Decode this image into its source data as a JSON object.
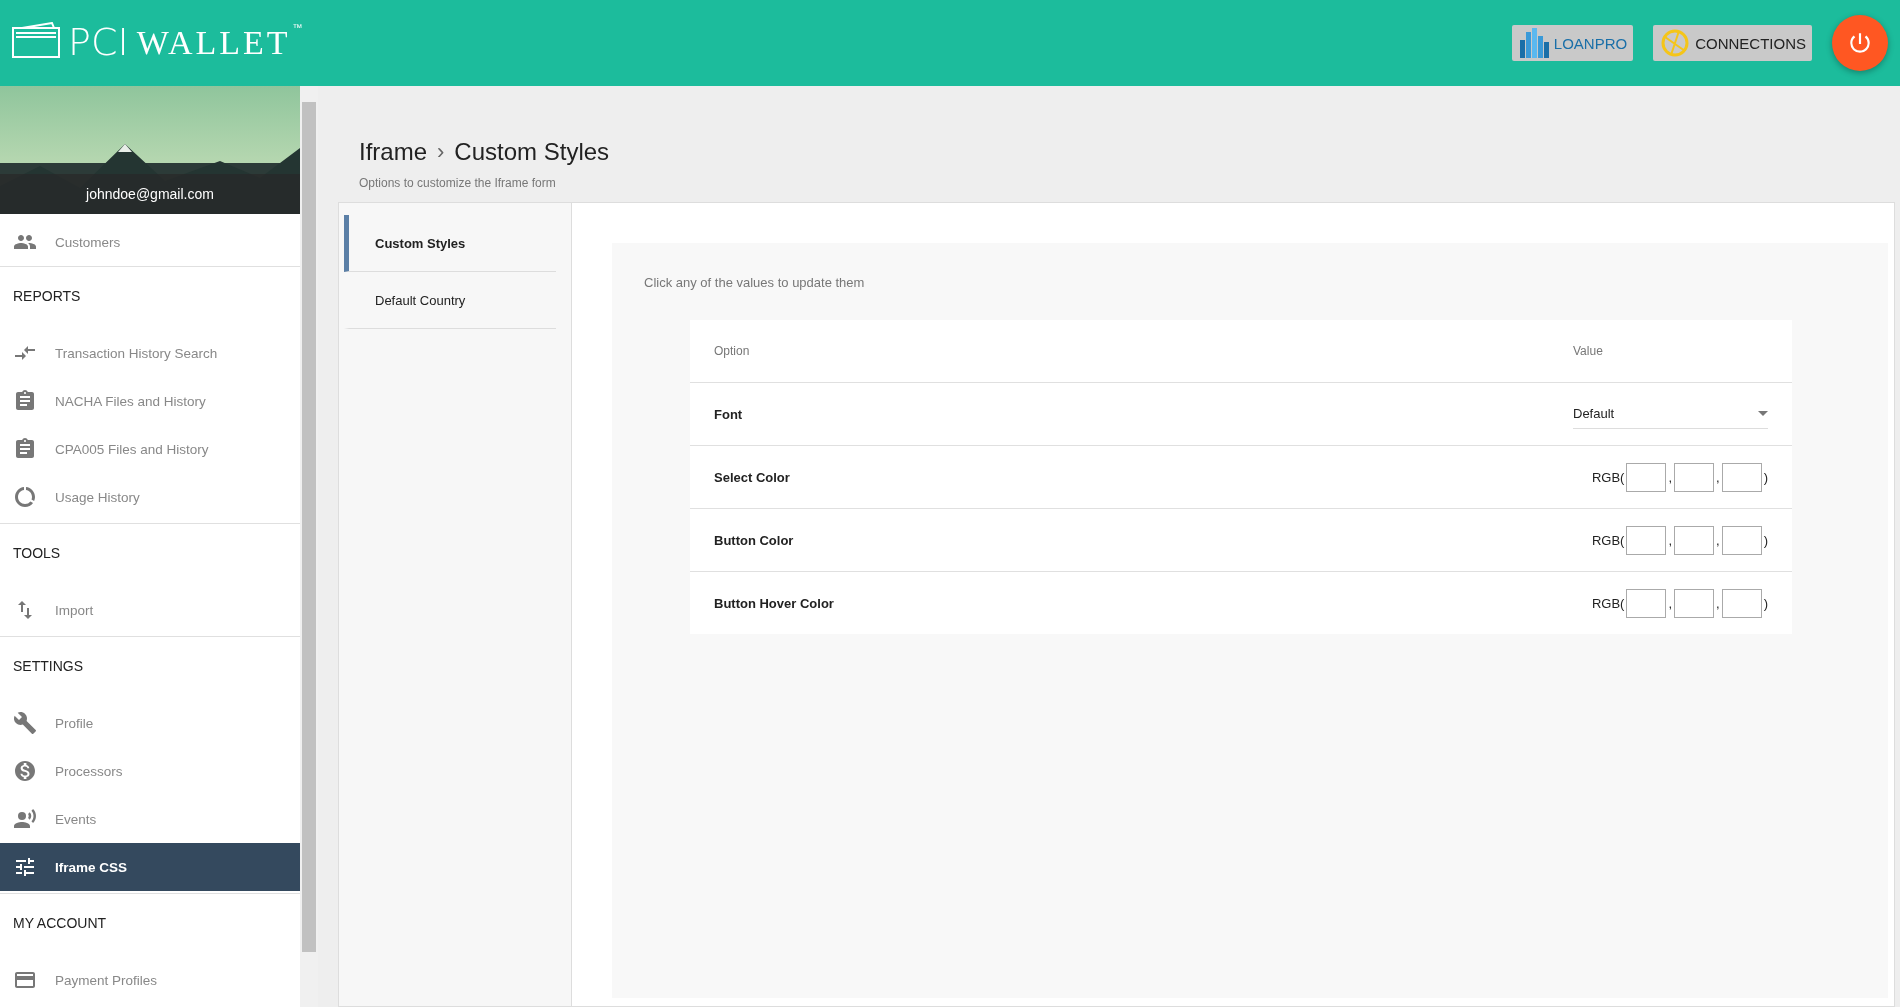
{
  "header": {
    "logo": {
      "first": "PCI",
      "second": "WALLET",
      "trademark": "™"
    },
    "buttons": [
      {
        "kind": "loanpro",
        "label": "LOANPRO"
      },
      {
        "kind": "connections",
        "label": "CONNECTIONS"
      }
    ]
  },
  "sidebar": {
    "user_email": "johndoe@gmail.com",
    "top_items": [
      {
        "label": "Customers",
        "selected": false
      }
    ],
    "sections": [
      {
        "heading": "REPORTS",
        "items": [
          {
            "label": "Transaction History Search",
            "selected": false
          },
          {
            "label": "NACHA Files and History",
            "selected": false
          },
          {
            "label": "CPA005 Files and History",
            "selected": false
          },
          {
            "label": "Usage History",
            "selected": false
          }
        ]
      },
      {
        "heading": "TOOLS",
        "items": [
          {
            "label": "Import",
            "selected": false
          }
        ]
      },
      {
        "heading": "SETTINGS",
        "items": [
          {
            "label": "Profile",
            "selected": false
          },
          {
            "label": "Processors",
            "selected": false
          },
          {
            "label": "Events",
            "selected": false
          },
          {
            "label": "Iframe CSS",
            "selected": true
          }
        ]
      },
      {
        "heading": "MY ACCOUNT",
        "items": [
          {
            "label": "Payment Profiles",
            "selected": false
          }
        ]
      }
    ]
  },
  "page": {
    "breadcrumb": [
      "Iframe",
      "Custom Styles"
    ],
    "breadcrumb_separator": "›",
    "subtitle": "Options to customize the Iframe form"
  },
  "tabs": [
    {
      "label": "Custom Styles",
      "selected": true
    },
    {
      "label": "Default Country",
      "selected": false
    }
  ],
  "panel": {
    "hint": "Click any of the values to update them",
    "table": {
      "columns": [
        "Option",
        "Value"
      ],
      "rows": [
        {
          "kind": "select",
          "option": "Font",
          "value": "Default"
        },
        {
          "kind": "rgb",
          "option": "Select Color",
          "prefix": "RGB(",
          "separators": [
            ",",
            ","
          ],
          "suffix": ")"
        },
        {
          "kind": "rgb",
          "option": "Button Color",
          "prefix": "RGB(",
          "separators": [
            ",",
            ","
          ],
          "suffix": ")"
        },
        {
          "kind": "rgb",
          "option": "Button Hover Color",
          "prefix": "RGB(",
          "separators": [
            ",",
            ","
          ],
          "suffix": ")"
        }
      ]
    }
  }
}
